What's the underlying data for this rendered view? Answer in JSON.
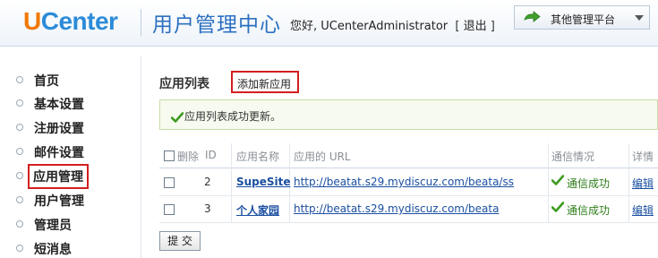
{
  "header": {
    "logo_u": "U",
    "logo_rest": "Center",
    "app_title": "用户管理中心",
    "greeting": "您好, UCenterAdministrator",
    "bracket_open": "[",
    "logout": "退出",
    "bracket_close": "]",
    "platform_menu": "其他管理平台"
  },
  "sidebar": {
    "items": [
      {
        "label": "首页"
      },
      {
        "label": "基本设置"
      },
      {
        "label": "注册设置"
      },
      {
        "label": "邮件设置"
      },
      {
        "label": "应用管理",
        "active": true
      },
      {
        "label": "用户管理"
      },
      {
        "label": "管理员"
      },
      {
        "label": "短消息"
      }
    ]
  },
  "main": {
    "title": "应用列表",
    "add_button": "添加新应用",
    "message": "应用列表成功更新。",
    "table": {
      "headers": {
        "delete": "删除",
        "id": "ID",
        "name": "应用名称",
        "url": "应用的 URL",
        "status": "通信情况",
        "detail": "详情"
      },
      "rows": [
        {
          "id": "2",
          "name": "SupeSite",
          "url": "http://beatat.s29.mydiscuz.com/beata/ss",
          "status": "通信成功",
          "detail": "编辑"
        },
        {
          "id": "3",
          "name": "个人家园",
          "url": "http://beatat.s29.mydiscuz.com/beata",
          "status": "通信成功",
          "detail": "编辑"
        }
      ]
    },
    "submit": "提 交"
  },
  "colors": {
    "logo_orange": "#f07800",
    "logo_blue": "#2c8bd8",
    "title_blue": "#2c70c0",
    "highlight_red": "#d21f1f",
    "success_green": "#2e7d18",
    "link_blue": "#1a4fa0"
  }
}
